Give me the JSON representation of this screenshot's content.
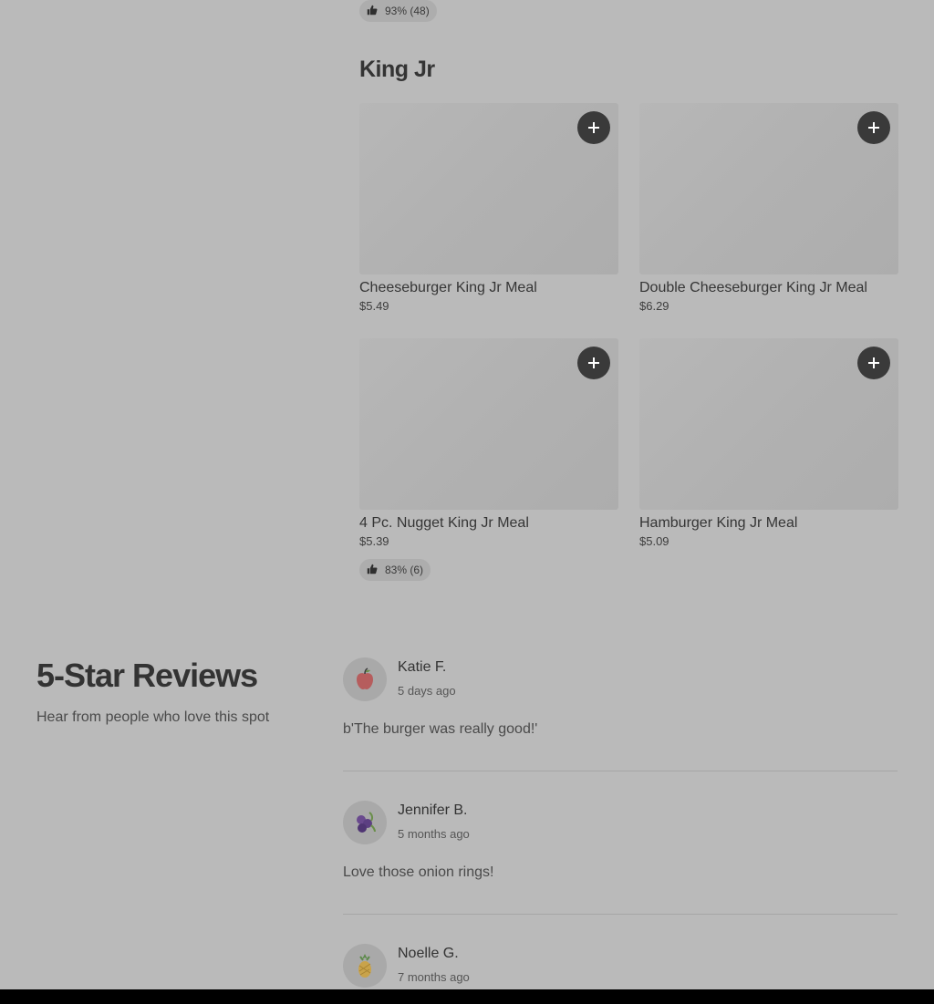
{
  "top_rating": {
    "text": "93% (48)"
  },
  "section": {
    "title": "King Jr"
  },
  "items": [
    {
      "name": "Cheeseburger King Jr Meal",
      "price": "$5.49"
    },
    {
      "name": "Double Cheeseburger King Jr Meal",
      "price": "$6.29"
    },
    {
      "name": "4 Pc. Nugget King Jr Meal",
      "price": "$5.39",
      "rating": "83% (6)"
    },
    {
      "name": "Hamburger King Jr Meal",
      "price": "$5.09"
    }
  ],
  "reviews_section": {
    "title": "5-Star Reviews",
    "subtitle": "Hear from people who love this spot"
  },
  "reviews": [
    {
      "name": "Katie F.",
      "date": "5 days ago",
      "text": "b'The burger was really good!'",
      "avatar": "apple-icon"
    },
    {
      "name": "Jennifer B.",
      "date": "5 months ago",
      "text": "Love those onion rings!",
      "avatar": "blueberries-icon"
    },
    {
      "name": "Noelle G.",
      "date": "7 months ago",
      "text": "",
      "avatar": "pineapple-icon"
    }
  ],
  "colors": {
    "overlay_bg": "#bababa",
    "add_button": "#3a3a3a",
    "bottom_bar": "#000000"
  }
}
